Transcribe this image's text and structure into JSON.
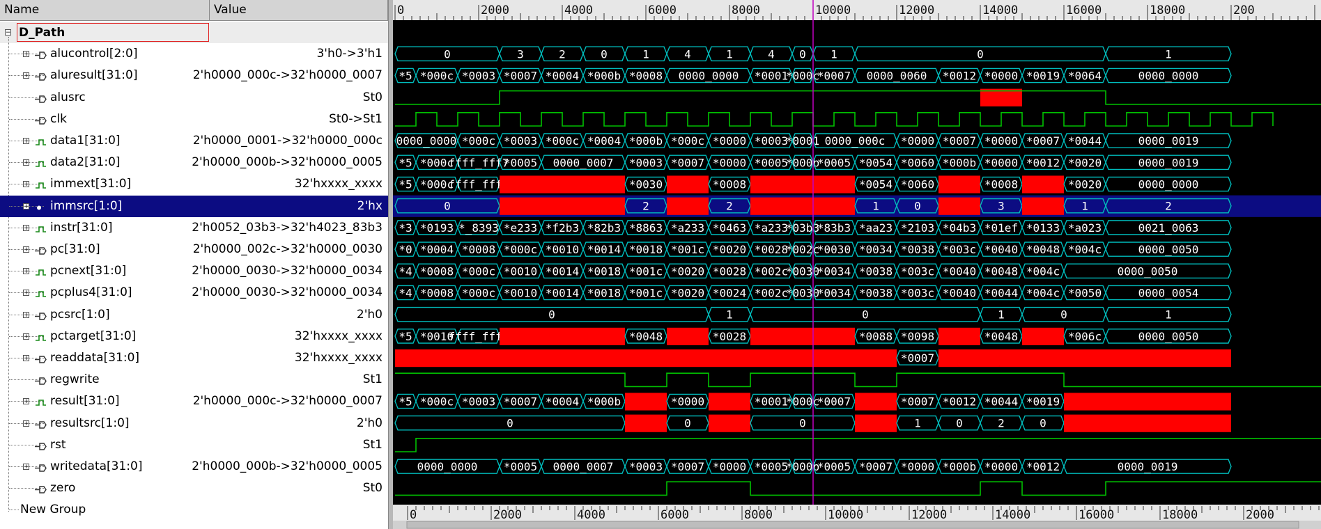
{
  "left_panel": {
    "header": {
      "name": "Name",
      "value": "Value"
    },
    "group": "D_Path",
    "signals": [
      {
        "id": "alucontrol",
        "name": "alucontrol[2:0]",
        "value": "3'h0->3'h1",
        "icon": "bus-output-icon"
      },
      {
        "id": "aluresult",
        "name": "aluresult[31:0]",
        "value": "2'h0000_000c->32'h0000_0007",
        "icon": "bus-output-icon"
      },
      {
        "id": "alusrc",
        "name": "alusrc",
        "value": "St0",
        "icon": "output-icon"
      },
      {
        "id": "clk",
        "name": "clk",
        "value": "St0->St1",
        "icon": "output-icon"
      },
      {
        "id": "data1",
        "name": "data1[31:0]",
        "value": "2'h0000_0001->32'h0000_000c",
        "icon": "register-icon"
      },
      {
        "id": "data2",
        "name": "data2[31:0]",
        "value": "2'h0000_000b->32'h0000_0005",
        "icon": "register-icon"
      },
      {
        "id": "immext",
        "name": "immext[31:0]",
        "value": "32'hxxxx_xxxx",
        "icon": "register-icon"
      },
      {
        "id": "immsrc",
        "name": "immsrc[1:0]",
        "value": "2'hx",
        "icon": "input-icon",
        "selected": true
      },
      {
        "id": "instr",
        "name": "instr[31:0]",
        "value": "2'h0052_03b3->32'h4023_83b3",
        "icon": "register-icon"
      },
      {
        "id": "pc",
        "name": "pc[31:0]",
        "value": "2'h0000_002c->32'h0000_0030",
        "icon": "bus-output-icon"
      },
      {
        "id": "pcnext",
        "name": "pcnext[31:0]",
        "value": "2'h0000_0030->32'h0000_0034",
        "icon": "register-icon"
      },
      {
        "id": "pcplus4",
        "name": "pcplus4[31:0]",
        "value": "2'h0000_0030->32'h0000_0034",
        "icon": "register-icon"
      },
      {
        "id": "pcsrc",
        "name": "pcsrc[1:0]",
        "value": "2'h0",
        "icon": "bus-output-icon"
      },
      {
        "id": "pctarget",
        "name": "pctarget[31:0]",
        "value": "32'hxxxx_xxxx",
        "icon": "register-icon"
      },
      {
        "id": "readdata",
        "name": "readdata[31:0]",
        "value": "32'hxxxx_xxxx",
        "icon": "bus-output-icon"
      },
      {
        "id": "regwrite",
        "name": "regwrite",
        "value": "St1",
        "icon": "output-icon"
      },
      {
        "id": "result",
        "name": "result[31:0]",
        "value": "2'h0000_000c->32'h0000_0007",
        "icon": "register-icon"
      },
      {
        "id": "resultsrc",
        "name": "resultsrc[1:0]",
        "value": "2'h0",
        "icon": "bus-output-icon"
      },
      {
        "id": "rst",
        "name": "rst",
        "value": "St1",
        "icon": "output-icon"
      },
      {
        "id": "writedata",
        "name": "writedata[31:0]",
        "value": "2'h0000_000b->32'h0000_0005",
        "icon": "bus-output-icon"
      },
      {
        "id": "zero",
        "name": "zero",
        "value": "St0",
        "icon": "output-icon"
      }
    ],
    "new_group": "New Group"
  },
  "timeline": {
    "top_ticks": [
      "0",
      "2000",
      "4000",
      "6000",
      "8000",
      "10000",
      "12000",
      "14000",
      "16000",
      "18000",
      "200"
    ],
    "bottom_ticks": [
      "0",
      "2000",
      "4000",
      "6000",
      "8000",
      "10000",
      "12000",
      "14000",
      "16000",
      "18000",
      "2000"
    ],
    "cursor_time": 10000
  },
  "waves": {
    "alucontrol": [
      [
        0,
        2500,
        "0"
      ],
      [
        2500,
        3500,
        "3"
      ],
      [
        3500,
        4500,
        "2"
      ],
      [
        4500,
        5500,
        "0"
      ],
      [
        5500,
        6500,
        "1"
      ],
      [
        6500,
        7500,
        "4"
      ],
      [
        7500,
        8500,
        "1"
      ],
      [
        8500,
        9500,
        "4"
      ],
      [
        9500,
        10000,
        "0"
      ],
      [
        10000,
        11000,
        "1"
      ],
      [
        11000,
        17000,
        "0"
      ],
      [
        17000,
        20000,
        "1"
      ]
    ],
    "aluresult": [
      [
        0,
        500,
        "*5"
      ],
      [
        500,
        1500,
        "*000c"
      ],
      [
        1500,
        2500,
        "*0003"
      ],
      [
        2500,
        3500,
        "*0007"
      ],
      [
        3500,
        4500,
        "*0004"
      ],
      [
        4500,
        5500,
        "*000b"
      ],
      [
        5500,
        6500,
        "*0008"
      ],
      [
        6500,
        8500,
        "0000_0000"
      ],
      [
        8500,
        9500,
        "*0001"
      ],
      [
        9500,
        10000,
        "*000c"
      ],
      [
        10000,
        11000,
        "*0007"
      ],
      [
        11000,
        13000,
        "0000_0060"
      ],
      [
        13000,
        14000,
        "*0012"
      ],
      [
        14000,
        15000,
        "*0000"
      ],
      [
        15000,
        16000,
        "*0019"
      ],
      [
        16000,
        17000,
        "*0064"
      ],
      [
        17000,
        20000,
        "0000_0000"
      ]
    ],
    "data1": [
      [
        0,
        1500,
        "0000_0000"
      ],
      [
        1500,
        2500,
        "*000c"
      ],
      [
        2500,
        3500,
        "*0003"
      ],
      [
        3500,
        4500,
        "*000c"
      ],
      [
        4500,
        5500,
        "*0004"
      ],
      [
        5500,
        6500,
        "*000b"
      ],
      [
        6500,
        7500,
        "*000c"
      ],
      [
        7500,
        8500,
        "*0000"
      ],
      [
        8500,
        9500,
        "*0003"
      ],
      [
        9500,
        10000,
        "*0001"
      ],
      [
        10000,
        12000,
        "0000_000c"
      ],
      [
        12000,
        13000,
        "*0000"
      ],
      [
        13000,
        14000,
        "*0007"
      ],
      [
        14000,
        15000,
        "*0000"
      ],
      [
        15000,
        16000,
        "*0007"
      ],
      [
        16000,
        17000,
        "*0044"
      ],
      [
        17000,
        20000,
        "0000_0019"
      ]
    ],
    "data2": [
      [
        0,
        500,
        "*5"
      ],
      [
        500,
        1500,
        "*000c"
      ],
      [
        1500,
        2500,
        "ffff_fff7"
      ],
      [
        2500,
        3500,
        "*0005"
      ],
      [
        3500,
        5500,
        "0000_0007"
      ],
      [
        5500,
        6500,
        "*0003"
      ],
      [
        6500,
        7500,
        "*0007"
      ],
      [
        7500,
        8500,
        "*0000"
      ],
      [
        8500,
        9500,
        "*0005"
      ],
      [
        9500,
        10000,
        "*000b"
      ],
      [
        10000,
        11000,
        "*0005"
      ],
      [
        11000,
        12000,
        "*0054"
      ],
      [
        12000,
        13000,
        "*0060"
      ],
      [
        13000,
        14000,
        "*000b"
      ],
      [
        14000,
        15000,
        "*0000"
      ],
      [
        15000,
        16000,
        "*0012"
      ],
      [
        16000,
        17000,
        "*0020"
      ],
      [
        17000,
        20000,
        "0000_0019"
      ]
    ],
    "immext": [
      [
        0,
        500,
        "*5"
      ],
      [
        500,
        1500,
        "*000c"
      ],
      [
        1500,
        2500,
        "ffff_fff7"
      ],
      [
        2500,
        5500,
        "x"
      ],
      [
        5500,
        6500,
        "*0030"
      ],
      [
        6500,
        7500,
        "x"
      ],
      [
        7500,
        8500,
        "*0008"
      ],
      [
        8500,
        11000,
        "x"
      ],
      [
        11000,
        12000,
        "*0054"
      ],
      [
        12000,
        13000,
        "*0060"
      ],
      [
        13000,
        14000,
        "x"
      ],
      [
        14000,
        15000,
        "*0008"
      ],
      [
        15000,
        16000,
        "x"
      ],
      [
        16000,
        17000,
        "*0020"
      ],
      [
        17000,
        20000,
        "0000_0000"
      ]
    ],
    "immsrc": [
      [
        0,
        2500,
        "0"
      ],
      [
        2500,
        5500,
        "x"
      ],
      [
        5500,
        6500,
        "2"
      ],
      [
        6500,
        7500,
        "x"
      ],
      [
        7500,
        8500,
        "2"
      ],
      [
        8500,
        11000,
        "x"
      ],
      [
        11000,
        12000,
        "1"
      ],
      [
        12000,
        13000,
        "0"
      ],
      [
        13000,
        14000,
        "x"
      ],
      [
        14000,
        15000,
        "3"
      ],
      [
        15000,
        16000,
        "x"
      ],
      [
        16000,
        17000,
        "1"
      ],
      [
        17000,
        20000,
        "2"
      ]
    ],
    "instr": [
      [
        0,
        500,
        "*3"
      ],
      [
        500,
        1500,
        "*0193"
      ],
      [
        1500,
        2500,
        "*_8393"
      ],
      [
        2500,
        3500,
        "*e233"
      ],
      [
        3500,
        4500,
        "*f2b3"
      ],
      [
        4500,
        5500,
        "*82b3"
      ],
      [
        5500,
        6500,
        "*8863"
      ],
      [
        6500,
        7500,
        "*a233"
      ],
      [
        7500,
        8500,
        "*0463"
      ],
      [
        8500,
        9500,
        "*a233"
      ],
      [
        9500,
        10000,
        "*03b3"
      ],
      [
        10000,
        11000,
        "*83b3"
      ],
      [
        11000,
        12000,
        "*aa23"
      ],
      [
        12000,
        13000,
        "*2103"
      ],
      [
        13000,
        14000,
        "*04b3"
      ],
      [
        14000,
        15000,
        "*01ef"
      ],
      [
        15000,
        16000,
        "*0133"
      ],
      [
        16000,
        17000,
        "*a023"
      ],
      [
        17000,
        20000,
        "0021_0063"
      ]
    ],
    "pc": [
      [
        0,
        500,
        "*0"
      ],
      [
        500,
        1500,
        "*0004"
      ],
      [
        1500,
        2500,
        "*0008"
      ],
      [
        2500,
        3500,
        "*000c"
      ],
      [
        3500,
        4500,
        "*0010"
      ],
      [
        4500,
        5500,
        "*0014"
      ],
      [
        5500,
        6500,
        "*0018"
      ],
      [
        6500,
        7500,
        "*001c"
      ],
      [
        7500,
        8500,
        "*0020"
      ],
      [
        8500,
        9500,
        "*0028"
      ],
      [
        9500,
        10000,
        "*002c"
      ],
      [
        10000,
        11000,
        "*0030"
      ],
      [
        11000,
        12000,
        "*0034"
      ],
      [
        12000,
        13000,
        "*0038"
      ],
      [
        13000,
        14000,
        "*003c"
      ],
      [
        14000,
        15000,
        "*0040"
      ],
      [
        15000,
        16000,
        "*0048"
      ],
      [
        16000,
        17000,
        "*004c"
      ],
      [
        17000,
        20000,
        "0000_0050"
      ]
    ],
    "pcnext": [
      [
        0,
        500,
        "*4"
      ],
      [
        500,
        1500,
        "*0008"
      ],
      [
        1500,
        2500,
        "*000c"
      ],
      [
        2500,
        3500,
        "*0010"
      ],
      [
        3500,
        4500,
        "*0014"
      ],
      [
        4500,
        5500,
        "*0018"
      ],
      [
        5500,
        6500,
        "*001c"
      ],
      [
        6500,
        7500,
        "*0020"
      ],
      [
        7500,
        8500,
        "*0028"
      ],
      [
        8500,
        9500,
        "*002c"
      ],
      [
        9500,
        10000,
        "*0030"
      ],
      [
        10000,
        11000,
        "*0034"
      ],
      [
        11000,
        12000,
        "*0038"
      ],
      [
        12000,
        13000,
        "*003c"
      ],
      [
        13000,
        14000,
        "*0040"
      ],
      [
        14000,
        15000,
        "*0048"
      ],
      [
        15000,
        16000,
        "*004c"
      ],
      [
        16000,
        20000,
        "0000_0050"
      ]
    ],
    "pcplus4": [
      [
        0,
        500,
        "*4"
      ],
      [
        500,
        1500,
        "*0008"
      ],
      [
        1500,
        2500,
        "*000c"
      ],
      [
        2500,
        3500,
        "*0010"
      ],
      [
        3500,
        4500,
        "*0014"
      ],
      [
        4500,
        5500,
        "*0018"
      ],
      [
        5500,
        6500,
        "*001c"
      ],
      [
        6500,
        7500,
        "*0020"
      ],
      [
        7500,
        8500,
        "*0024"
      ],
      [
        8500,
        9500,
        "*002c"
      ],
      [
        9500,
        10000,
        "*0030"
      ],
      [
        10000,
        11000,
        "*0034"
      ],
      [
        11000,
        12000,
        "*0038"
      ],
      [
        12000,
        13000,
        "*003c"
      ],
      [
        13000,
        14000,
        "*0040"
      ],
      [
        14000,
        15000,
        "*0044"
      ],
      [
        15000,
        16000,
        "*004c"
      ],
      [
        16000,
        17000,
        "*0050"
      ],
      [
        17000,
        20000,
        "0000_0054"
      ]
    ],
    "pcsrc": [
      [
        0,
        7500,
        "0"
      ],
      [
        7500,
        8500,
        "1"
      ],
      [
        8500,
        14000,
        "0"
      ],
      [
        14000,
        15000,
        "1"
      ],
      [
        15000,
        17000,
        "0"
      ],
      [
        17000,
        20000,
        "1"
      ]
    ],
    "pctarget": [
      [
        0,
        500,
        "*5"
      ],
      [
        500,
        1500,
        "*0010"
      ],
      [
        1500,
        2500,
        "ffff_ffff"
      ],
      [
        2500,
        5500,
        "x"
      ],
      [
        5500,
        6500,
        "*0048"
      ],
      [
        6500,
        7500,
        "x"
      ],
      [
        7500,
        8500,
        "*0028"
      ],
      [
        8500,
        11000,
        "x"
      ],
      [
        11000,
        12000,
        "*0088"
      ],
      [
        12000,
        13000,
        "*0098"
      ],
      [
        13000,
        14000,
        "x"
      ],
      [
        14000,
        15000,
        "*0048"
      ],
      [
        15000,
        16000,
        "x"
      ],
      [
        16000,
        17000,
        "*006c"
      ],
      [
        17000,
        20000,
        "0000_0050"
      ]
    ],
    "readdata": [
      [
        0,
        12000,
        "x"
      ],
      [
        12000,
        13000,
        "*0007"
      ],
      [
        13000,
        20000,
        "x"
      ]
    ],
    "result": [
      [
        0,
        500,
        "*5"
      ],
      [
        500,
        1500,
        "*000c"
      ],
      [
        1500,
        2500,
        "*0003"
      ],
      [
        2500,
        3500,
        "*0007"
      ],
      [
        3500,
        4500,
        "*0004"
      ],
      [
        4500,
        5500,
        "*000b"
      ],
      [
        5500,
        6500,
        "x"
      ],
      [
        6500,
        7500,
        "*0000"
      ],
      [
        7500,
        8500,
        "x"
      ],
      [
        8500,
        9500,
        "*0001"
      ],
      [
        9500,
        10000,
        "*000c"
      ],
      [
        10000,
        11000,
        "*0007"
      ],
      [
        11000,
        12000,
        "x"
      ],
      [
        12000,
        13000,
        "*0007"
      ],
      [
        13000,
        14000,
        "*0012"
      ],
      [
        14000,
        15000,
        "*0044"
      ],
      [
        15000,
        16000,
        "*0019"
      ],
      [
        16000,
        20000,
        "x"
      ]
    ],
    "resultsrc": [
      [
        0,
        5500,
        "0"
      ],
      [
        5500,
        6500,
        "x"
      ],
      [
        6500,
        7500,
        "0"
      ],
      [
        7500,
        8500,
        "x"
      ],
      [
        8500,
        11000,
        "0"
      ],
      [
        11000,
        12000,
        "x"
      ],
      [
        12000,
        13000,
        "1"
      ],
      [
        13000,
        14000,
        "0"
      ],
      [
        14000,
        15000,
        "2"
      ],
      [
        15000,
        16000,
        "0"
      ],
      [
        16000,
        20000,
        "x"
      ]
    ],
    "writedata": [
      [
        0,
        2500,
        "0000_0000"
      ],
      [
        2500,
        3500,
        "*0005"
      ],
      [
        3500,
        5500,
        "0000_0007"
      ],
      [
        5500,
        6500,
        "*0003"
      ],
      [
        6500,
        7500,
        "*0007"
      ],
      [
        7500,
        8500,
        "*0000"
      ],
      [
        8500,
        9500,
        "*0005"
      ],
      [
        9500,
        10000,
        "*000b"
      ],
      [
        10000,
        11000,
        "*0005"
      ],
      [
        11000,
        12000,
        "*0007"
      ],
      [
        12000,
        13000,
        "*0000"
      ],
      [
        13000,
        14000,
        "*000b"
      ],
      [
        14000,
        15000,
        "*0000"
      ],
      [
        15000,
        16000,
        "*0012"
      ],
      [
        16000,
        20000,
        "0000_0019"
      ]
    ],
    "alusrc_edges": [
      [
        0,
        0
      ],
      [
        2500,
        1
      ],
      [
        11000,
        1
      ],
      [
        13000,
        1
      ],
      [
        15000,
        1
      ],
      [
        17000,
        0
      ]
    ],
    "alusrc_x": [
      [
        14000,
        15000
      ]
    ],
    "regwrite_edges": [
      [
        0,
        1
      ],
      [
        5500,
        0
      ],
      [
        6500,
        1
      ],
      [
        7500,
        0
      ],
      [
        8500,
        1
      ],
      [
        11000,
        0
      ],
      [
        12000,
        1
      ],
      [
        16000,
        0
      ]
    ],
    "rst_edges": [
      [
        0,
        0
      ],
      [
        500,
        1
      ]
    ],
    "zero_edges": [
      [
        0,
        0
      ],
      [
        6500,
        1
      ],
      [
        8500,
        0
      ],
      [
        14000,
        1
      ],
      [
        15000,
        0
      ],
      [
        17000,
        1
      ]
    ]
  },
  "colors": {
    "bus": "#00bcbc",
    "bit": "#00c000",
    "unknown": "#ff0000",
    "cursor": "#c000c0",
    "selection": "#0c0c82",
    "text": "#ffffff"
  }
}
